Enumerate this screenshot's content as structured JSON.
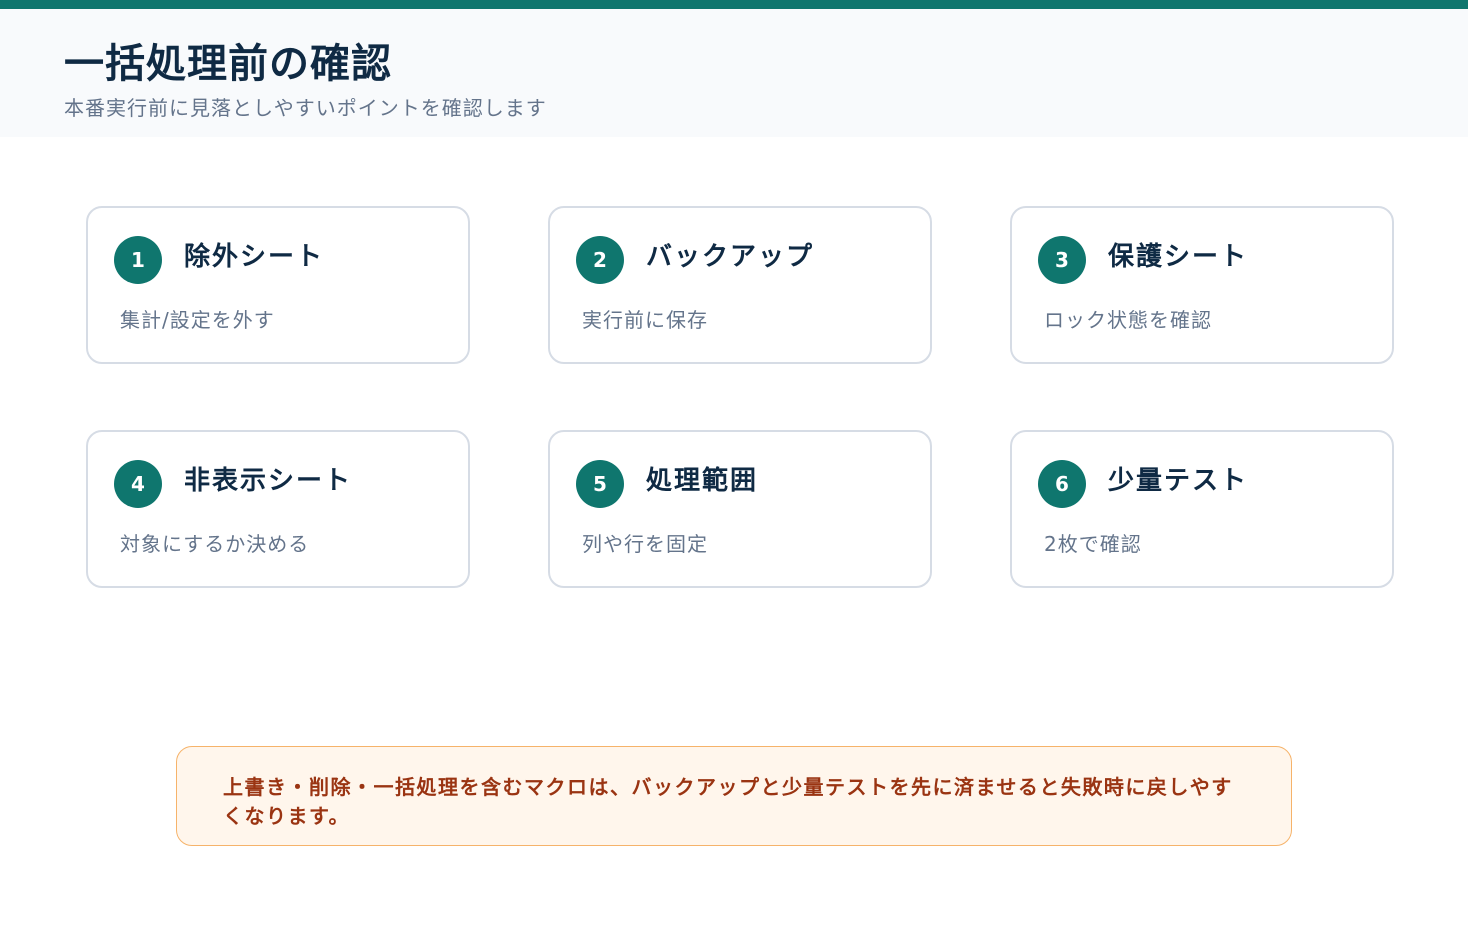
{
  "header": {
    "title": "一括処理前の確認",
    "subtitle": "本番実行前に見落としやすいポイントを確認します"
  },
  "cards": [
    {
      "number": "1",
      "title": "除外シート",
      "description": "集計/設定を外す"
    },
    {
      "number": "2",
      "title": "バックアップ",
      "description": "実行前に保存"
    },
    {
      "number": "3",
      "title": "保護シート",
      "description": "ロック状態を確認"
    },
    {
      "number": "4",
      "title": "非表示シート",
      "description": "対象にするか決める"
    },
    {
      "number": "5",
      "title": "処理範囲",
      "description": "列や行を固定"
    },
    {
      "number": "6",
      "title": "少量テスト",
      "description": "2枚で確認"
    }
  ],
  "note": {
    "text": "上書き・削除・一括処理を含むマクロは、バックアップと少量テストを先に済ませると失敗時に戻しやすくなります。"
  },
  "colors": {
    "accent": "#0f766e",
    "title_text": "#0f2a44",
    "muted_text": "#64748b",
    "note_background": "#fff6ec",
    "note_border": "#f6b36a",
    "note_text": "#9a3412"
  }
}
